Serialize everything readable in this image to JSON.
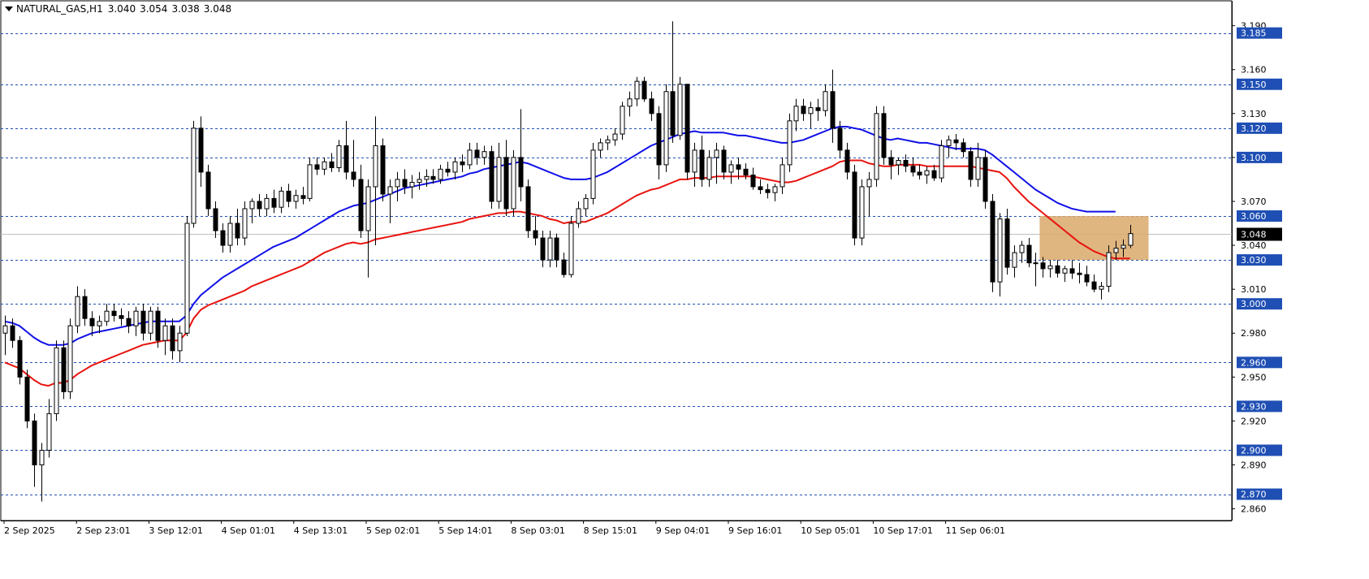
{
  "header": {
    "symbol": "NATURAL_GAS,H1",
    "open": "3.040",
    "high": "3.054",
    "low": "3.038",
    "close": "3.048"
  },
  "colors": {
    "bull_candle": "#ffffff",
    "bear_candle": "#000000",
    "ma_fast": "#e8130e",
    "ma_slow": "#1010e8",
    "level_line": "#1f4fb4",
    "level_label_bg": "#1f4fb4",
    "zone_fill": "#d9a86a",
    "grid_text": "#000000"
  },
  "chart_data": {
    "type": "line",
    "title": "",
    "xlabel": "",
    "ylabel": "",
    "ylim": [
      2.852,
      3.207
    ],
    "y_ticks": [
      "3.190",
      "3.160",
      "3.130",
      "3.100",
      "3.070",
      "3.040",
      "3.010",
      "2.980",
      "2.950",
      "2.920",
      "2.890",
      "2.860"
    ],
    "x_labels": [
      "2 Sep 2025",
      "2 Sep 23:01",
      "3 Sep 12:01",
      "4 Sep 01:01",
      "4 Sep 13:01",
      "5 Sep 02:01",
      "5 Sep 14:01",
      "8 Sep 03:01",
      "8 Sep 15:01",
      "9 Sep 04:01",
      "9 Sep 16:01",
      "10 Sep 05:01",
      "10 Sep 17:01",
      "11 Sep 06:01"
    ],
    "levels": [
      "3.185",
      "3.150",
      "3.120",
      "3.100",
      "3.060",
      "3.030",
      "3.000",
      "2.960",
      "2.930",
      "2.900",
      "2.870"
    ],
    "current_price": "3.048",
    "zone": {
      "from_bar": 143,
      "to_bar": 158,
      "low": 3.03,
      "high": 3.06
    },
    "candles_ohlc": [
      [
        2.98,
        2.992,
        2.965,
        2.985
      ],
      [
        2.985,
        2.99,
        2.97,
        2.975
      ],
      [
        2.975,
        2.978,
        2.945,
        2.95
      ],
      [
        2.95,
        2.955,
        2.915,
        2.92
      ],
      [
        2.92,
        2.925,
        2.875,
        2.89
      ],
      [
        2.89,
        2.905,
        2.865,
        2.9
      ],
      [
        2.9,
        2.935,
        2.895,
        2.925
      ],
      [
        2.925,
        2.975,
        2.92,
        2.97
      ],
      [
        2.97,
        2.975,
        2.935,
        2.94
      ],
      [
        2.94,
        2.99,
        2.935,
        2.985
      ],
      [
        2.985,
        3.012,
        2.98,
        3.005
      ],
      [
        3.005,
        3.01,
        2.985,
        2.99
      ],
      [
        2.99,
        2.995,
        2.978,
        2.985
      ],
      [
        2.985,
        2.992,
        2.98,
        2.988
      ],
      [
        2.988,
        3.0,
        2.985,
        2.995
      ],
      [
        2.995,
        3.0,
        2.988,
        2.992
      ],
      [
        2.992,
        2.997,
        2.985,
        2.99
      ],
      [
        2.99,
        2.995,
        2.98,
        2.985
      ],
      [
        2.985,
        2.998,
        2.978,
        2.995
      ],
      [
        2.995,
        3.0,
        2.975,
        2.98
      ],
      [
        2.98,
        2.998,
        2.975,
        2.995
      ],
      [
        2.995,
        2.998,
        2.97,
        2.975
      ],
      [
        2.975,
        2.99,
        2.965,
        2.985
      ],
      [
        2.985,
        2.99,
        2.962,
        2.968
      ],
      [
        2.968,
        2.985,
        2.96,
        2.98
      ],
      [
        2.98,
        3.06,
        2.978,
        3.055
      ],
      [
        3.055,
        3.125,
        3.052,
        3.12
      ],
      [
        3.12,
        3.128,
        3.08,
        3.09
      ],
      [
        3.09,
        3.095,
        3.06,
        3.065
      ],
      [
        3.065,
        3.07,
        3.045,
        3.05
      ],
      [
        3.05,
        3.055,
        3.035,
        3.04
      ],
      [
        3.04,
        3.06,
        3.035,
        3.055
      ],
      [
        3.055,
        3.065,
        3.04,
        3.045
      ],
      [
        3.045,
        3.07,
        3.04,
        3.065
      ],
      [
        3.065,
        3.072,
        3.055,
        3.07
      ],
      [
        3.07,
        3.075,
        3.06,
        3.065
      ],
      [
        3.065,
        3.075,
        3.06,
        3.072
      ],
      [
        3.072,
        3.078,
        3.062,
        3.066
      ],
      [
        3.066,
        3.08,
        3.062,
        3.077
      ],
      [
        3.077,
        3.082,
        3.066,
        3.07
      ],
      [
        3.07,
        3.078,
        3.065,
        3.074
      ],
      [
        3.074,
        3.08,
        3.068,
        3.072
      ],
      [
        3.072,
        3.1,
        3.07,
        3.095
      ],
      [
        3.095,
        3.1,
        3.088,
        3.092
      ],
      [
        3.092,
        3.1,
        3.088,
        3.097
      ],
      [
        3.097,
        3.103,
        3.09,
        3.093
      ],
      [
        3.093,
        3.112,
        3.09,
        3.108
      ],
      [
        3.108,
        3.125,
        3.085,
        3.09
      ],
      [
        3.09,
        3.112,
        3.08,
        3.085
      ],
      [
        3.085,
        3.095,
        3.045,
        3.05
      ],
      [
        3.05,
        3.085,
        3.018,
        3.08
      ],
      [
        3.08,
        3.128,
        3.04,
        3.108
      ],
      [
        3.108,
        3.113,
        3.07,
        3.075
      ],
      [
        3.075,
        3.085,
        3.055,
        3.08
      ],
      [
        3.08,
        3.09,
        3.07,
        3.085
      ],
      [
        3.085,
        3.092,
        3.075,
        3.08
      ],
      [
        3.08,
        3.088,
        3.072,
        3.083
      ],
      [
        3.083,
        3.09,
        3.078,
        3.085
      ],
      [
        3.085,
        3.092,
        3.08,
        3.087
      ],
      [
        3.087,
        3.092,
        3.082,
        3.085
      ],
      [
        3.085,
        3.095,
        3.082,
        3.092
      ],
      [
        3.092,
        3.097,
        3.087,
        3.09
      ],
      [
        3.09,
        3.1,
        3.085,
        3.097
      ],
      [
        3.097,
        3.102,
        3.09,
        3.095
      ],
      [
        3.095,
        3.11,
        3.092,
        3.105
      ],
      [
        3.105,
        3.11,
        3.095,
        3.1
      ],
      [
        3.1,
        3.108,
        3.095,
        3.104
      ],
      [
        3.104,
        3.108,
        3.065,
        3.07
      ],
      [
        3.07,
        3.11,
        3.065,
        3.1
      ],
      [
        3.1,
        3.112,
        3.06,
        3.065
      ],
      [
        3.065,
        3.105,
        3.06,
        3.1
      ],
      [
        3.1,
        3.133,
        3.07,
        3.08
      ],
      [
        3.08,
        3.085,
        3.045,
        3.05
      ],
      [
        3.05,
        3.06,
        3.04,
        3.045
      ],
      [
        3.045,
        3.05,
        3.025,
        3.03
      ],
      [
        3.03,
        3.05,
        3.025,
        3.045
      ],
      [
        3.045,
        3.048,
        3.025,
        3.03
      ],
      [
        3.03,
        3.035,
        3.018,
        3.02
      ],
      [
        3.02,
        3.06,
        3.018,
        3.055
      ],
      [
        3.055,
        3.07,
        3.052,
        3.065
      ],
      [
        3.065,
        3.075,
        3.06,
        3.072
      ],
      [
        3.072,
        3.11,
        3.068,
        3.105
      ],
      [
        3.105,
        3.113,
        3.1,
        3.11
      ],
      [
        3.11,
        3.115,
        3.105,
        3.112
      ],
      [
        3.112,
        3.12,
        3.108,
        3.116
      ],
      [
        3.116,
        3.138,
        3.112,
        3.135
      ],
      [
        3.135,
        3.145,
        3.128,
        3.14
      ],
      [
        3.14,
        3.155,
        3.135,
        3.152
      ],
      [
        3.152,
        3.155,
        3.138,
        3.14
      ],
      [
        3.14,
        3.145,
        3.125,
        3.13
      ],
      [
        3.13,
        3.135,
        3.085,
        3.095
      ],
      [
        3.095,
        3.15,
        3.09,
        3.145
      ],
      [
        3.145,
        3.193,
        3.11,
        3.115
      ],
      [
        3.115,
        3.155,
        3.112,
        3.15
      ],
      [
        3.15,
        3.15,
        3.085,
        3.09
      ],
      [
        3.09,
        3.11,
        3.08,
        3.105
      ],
      [
        3.105,
        3.115,
        3.08,
        3.085
      ],
      [
        3.085,
        3.105,
        3.08,
        3.1
      ],
      [
        3.1,
        3.11,
        3.082,
        3.105
      ],
      [
        3.105,
        3.108,
        3.085,
        3.09
      ],
      [
        3.09,
        3.098,
        3.082,
        3.095
      ],
      [
        3.095,
        3.1,
        3.085,
        3.092
      ],
      [
        3.092,
        3.096,
        3.085,
        3.088
      ],
      [
        3.088,
        3.093,
        3.078,
        3.08
      ],
      [
        3.08,
        3.085,
        3.075,
        3.078
      ],
      [
        3.078,
        3.082,
        3.072,
        3.076
      ],
      [
        3.076,
        3.082,
        3.07,
        3.08
      ],
      [
        3.08,
        3.1,
        3.075,
        3.095
      ],
      [
        3.095,
        3.13,
        3.09,
        3.125
      ],
      [
        3.125,
        3.14,
        3.118,
        3.135
      ],
      [
        3.135,
        3.14,
        3.125,
        3.13
      ],
      [
        3.13,
        3.138,
        3.12,
        3.134
      ],
      [
        3.134,
        3.14,
        3.125,
        3.132
      ],
      [
        3.132,
        3.15,
        3.128,
        3.145
      ],
      [
        3.145,
        3.16,
        3.11,
        3.12
      ],
      [
        3.12,
        3.125,
        3.1,
        3.105
      ],
      [
        3.105,
        3.11,
        3.085,
        3.09
      ],
      [
        3.09,
        3.095,
        3.04,
        3.045
      ],
      [
        3.045,
        3.085,
        3.04,
        3.08
      ],
      [
        3.08,
        3.09,
        3.06,
        3.085
      ],
      [
        3.085,
        3.135,
        3.08,
        3.13
      ],
      [
        3.13,
        3.135,
        3.095,
        3.1
      ],
      [
        3.1,
        3.105,
        3.085,
        3.095
      ],
      [
        3.095,
        3.1,
        3.088,
        3.098
      ],
      [
        3.098,
        3.102,
        3.09,
        3.094
      ],
      [
        3.094,
        3.1,
        3.087,
        3.09
      ],
      [
        3.09,
        3.095,
        3.085,
        3.088
      ],
      [
        3.088,
        3.094,
        3.082,
        3.091
      ],
      [
        3.091,
        3.095,
        3.084,
        3.086
      ],
      [
        3.086,
        3.112,
        3.083,
        3.108
      ],
      [
        3.108,
        3.115,
        3.1,
        3.112
      ],
      [
        3.112,
        3.116,
        3.105,
        3.11
      ],
      [
        3.11,
        3.113,
        3.1,
        3.104
      ],
      [
        3.104,
        3.107,
        3.08,
        3.085
      ],
      [
        3.085,
        3.11,
        3.08,
        3.1
      ],
      [
        3.1,
        3.105,
        3.065,
        3.07
      ],
      [
        3.07,
        3.075,
        3.008,
        3.015
      ],
      [
        3.015,
        3.062,
        3.005,
        3.058
      ],
      [
        3.058,
        3.065,
        3.02,
        3.025
      ],
      [
        3.025,
        3.04,
        3.018,
        3.035
      ],
      [
        3.035,
        3.043,
        3.028,
        3.04
      ],
      [
        3.04,
        3.045,
        3.025,
        3.028
      ],
      [
        3.028,
        3.035,
        3.012,
        3.028
      ],
      [
        3.028,
        3.032,
        3.018,
        3.024
      ],
      [
        3.024,
        3.03,
        3.018,
        3.026
      ],
      [
        3.026,
        3.03,
        3.018,
        3.021
      ],
      [
        3.021,
        3.026,
        3.015,
        3.024
      ],
      [
        3.024,
        3.03,
        3.017,
        3.021
      ],
      [
        3.021,
        3.028,
        3.014,
        3.02
      ],
      [
        3.02,
        3.026,
        3.012,
        3.015
      ],
      [
        3.015,
        3.02,
        3.008,
        3.01
      ],
      [
        3.01,
        3.015,
        3.003,
        3.012
      ],
      [
        3.012,
        3.04,
        3.008,
        3.035
      ],
      [
        3.035,
        3.043,
        3.03,
        3.038
      ],
      [
        3.038,
        3.044,
        3.032,
        3.04
      ],
      [
        3.04,
        3.054,
        3.038,
        3.048
      ]
    ],
    "series": [
      {
        "role": "fast_ma",
        "values": [
          2.96,
          2.958,
          2.956,
          2.952,
          2.948,
          2.945,
          2.944,
          2.946,
          2.946,
          2.948,
          2.952,
          2.955,
          2.958,
          2.96,
          2.962,
          2.964,
          2.966,
          2.968,
          2.97,
          2.972,
          2.973,
          2.974,
          2.975,
          2.975,
          2.975,
          2.98,
          2.99,
          2.996,
          2.999,
          3.001,
          3.003,
          3.005,
          3.007,
          3.009,
          3.012,
          3.014,
          3.016,
          3.018,
          3.02,
          3.022,
          3.024,
          3.026,
          3.029,
          3.032,
          3.035,
          3.037,
          3.039,
          3.041,
          3.042,
          3.041,
          3.042,
          3.044,
          3.045,
          3.046,
          3.047,
          3.048,
          3.049,
          3.05,
          3.051,
          3.052,
          3.053,
          3.054,
          3.055,
          3.056,
          3.058,
          3.059,
          3.06,
          3.061,
          3.062,
          3.062,
          3.063,
          3.063,
          3.062,
          3.061,
          3.06,
          3.058,
          3.057,
          3.055,
          3.056,
          3.056,
          3.056,
          3.058,
          3.06,
          3.062,
          3.065,
          3.068,
          3.071,
          3.074,
          3.076,
          3.078,
          3.079,
          3.081,
          3.083,
          3.085,
          3.085,
          3.086,
          3.086,
          3.086,
          3.087,
          3.087,
          3.087,
          3.087,
          3.087,
          3.087,
          3.086,
          3.085,
          3.084,
          3.083,
          3.083,
          3.084,
          3.086,
          3.088,
          3.09,
          3.092,
          3.094,
          3.097,
          3.098,
          3.098,
          3.098,
          3.096,
          3.095,
          3.094,
          3.094,
          3.095,
          3.095,
          3.095,
          3.095,
          3.094,
          3.094,
          3.094,
          3.094,
          3.094,
          3.094,
          3.094,
          3.093,
          3.092,
          3.091,
          3.09,
          3.086,
          3.08,
          3.075,
          3.07,
          3.066,
          3.062,
          3.058,
          3.054,
          3.05,
          3.046,
          3.042,
          3.039,
          3.036,
          3.034,
          3.032,
          3.031,
          3.031,
          3.031
        ]
      },
      {
        "role": "slow_ma",
        "values": [
          2.988,
          2.987,
          2.985,
          2.981,
          2.977,
          2.974,
          2.972,
          2.972,
          2.972,
          2.973,
          2.976,
          2.978,
          2.98,
          2.981,
          2.982,
          2.983,
          2.984,
          2.985,
          2.986,
          2.987,
          2.988,
          2.988,
          2.988,
          2.988,
          2.988,
          2.992,
          3.0,
          3.006,
          3.01,
          3.014,
          3.018,
          3.021,
          3.024,
          3.027,
          3.03,
          3.033,
          3.036,
          3.039,
          3.041,
          3.043,
          3.045,
          3.048,
          3.051,
          3.054,
          3.057,
          3.06,
          3.063,
          3.065,
          3.067,
          3.068,
          3.069,
          3.071,
          3.073,
          3.075,
          3.077,
          3.079,
          3.08,
          3.081,
          3.082,
          3.083,
          3.084,
          3.085,
          3.086,
          3.087,
          3.089,
          3.09,
          3.092,
          3.093,
          3.094,
          3.095,
          3.096,
          3.097,
          3.096,
          3.094,
          3.092,
          3.09,
          3.088,
          3.086,
          3.085,
          3.085,
          3.085,
          3.086,
          3.088,
          3.09,
          3.093,
          3.096,
          3.099,
          3.102,
          3.105,
          3.108,
          3.11,
          3.112,
          3.114,
          3.116,
          3.117,
          3.118,
          3.117,
          3.117,
          3.117,
          3.117,
          3.116,
          3.115,
          3.115,
          3.114,
          3.113,
          3.112,
          3.111,
          3.11,
          3.11,
          3.111,
          3.112,
          3.114,
          3.116,
          3.118,
          3.12,
          3.121,
          3.121,
          3.12,
          3.119,
          3.117,
          3.115,
          3.113,
          3.112,
          3.113,
          3.112,
          3.111,
          3.11,
          3.11,
          3.109,
          3.108,
          3.107,
          3.106,
          3.106,
          3.106,
          3.106,
          3.105,
          3.102,
          3.098,
          3.094,
          3.09,
          3.086,
          3.082,
          3.078,
          3.075,
          3.072,
          3.069,
          3.067,
          3.065,
          3.064,
          3.063,
          3.063,
          3.063,
          3.063,
          3.063
        ]
      }
    ]
  }
}
